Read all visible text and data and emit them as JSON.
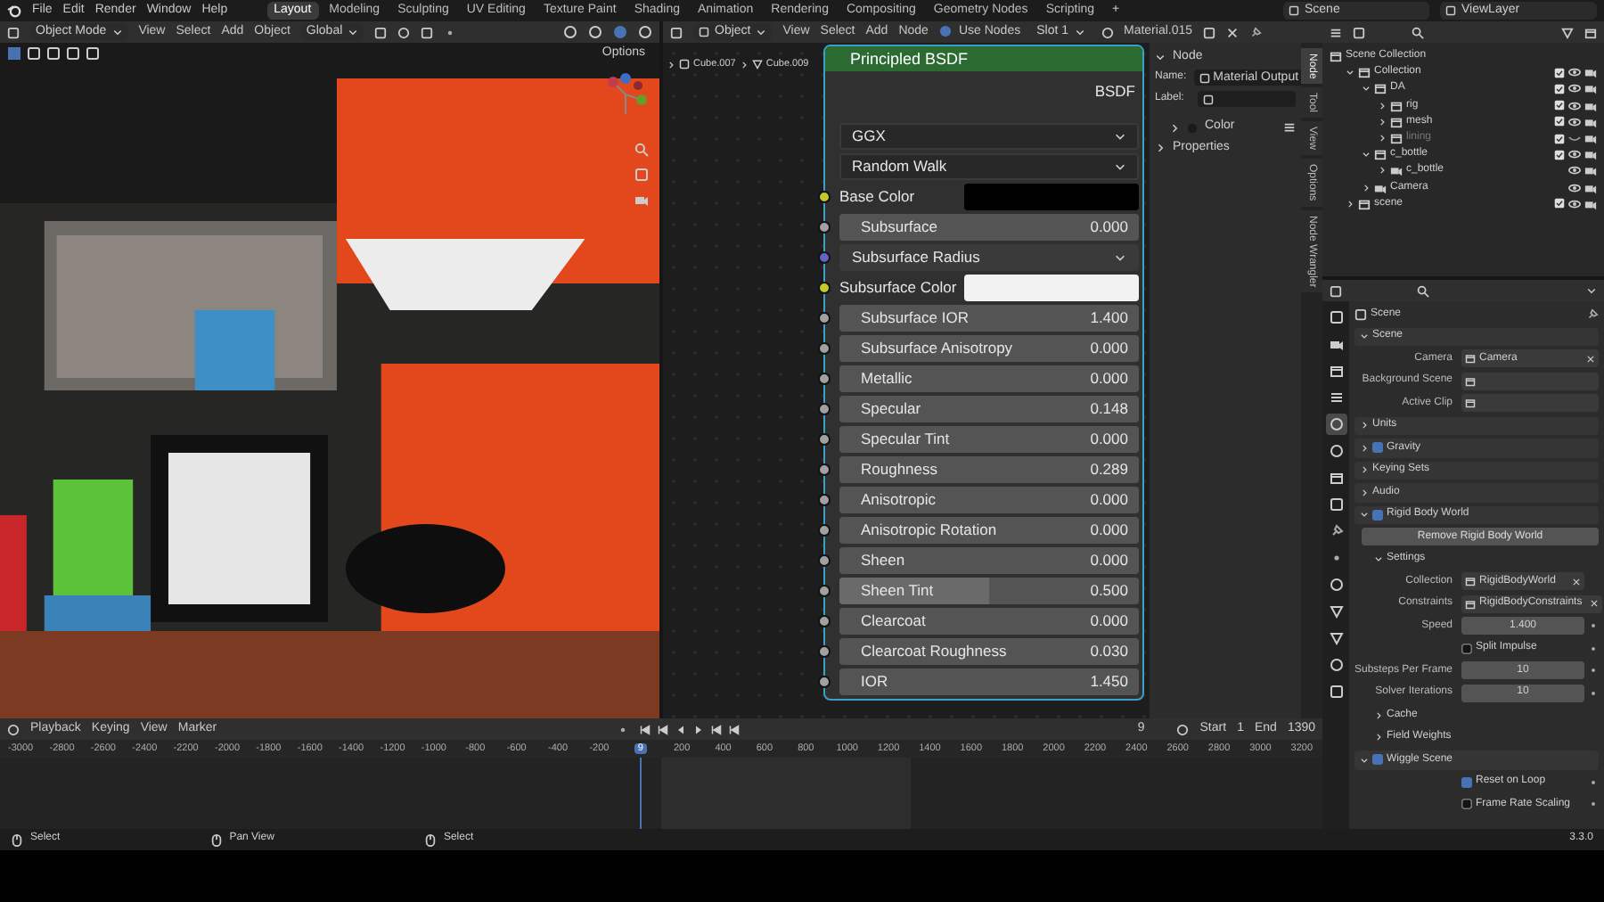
{
  "top_bar": {
    "menus": [
      "File",
      "Edit",
      "Render",
      "Window",
      "Help"
    ],
    "workspaces": [
      {
        "label": "Layout",
        "selected": true
      },
      {
        "label": "Modeling",
        "selected": false
      },
      {
        "label": "Sculpting",
        "selected": false
      },
      {
        "label": "UV Editing",
        "selected": false
      },
      {
        "label": "Texture Paint",
        "selected": false
      },
      {
        "label": "Shading",
        "selected": false
      },
      {
        "label": "Animation",
        "selected": false
      },
      {
        "label": "Rendering",
        "selected": false
      },
      {
        "label": "Compositing",
        "selected": false
      },
      {
        "label": "Geometry Nodes",
        "selected": false
      },
      {
        "label": "Scripting",
        "selected": false
      }
    ],
    "add_tab": "+",
    "scene": "Scene",
    "view_layer": "ViewLayer"
  },
  "viewport": {
    "mode": "Object Mode",
    "menus": [
      "View",
      "Select",
      "Add",
      "Object"
    ],
    "orientation": "Global",
    "options": "Options"
  },
  "node_editor": {
    "object_type": "Object",
    "menus": [
      "View",
      "Select",
      "Add",
      "Node"
    ],
    "use_nodes": {
      "label": "Use Nodes",
      "checked": true
    },
    "slot": "Slot 1",
    "material": "Material.015",
    "breadcrumbs": [
      "Cube.007",
      "Cube.009"
    ],
    "node": {
      "title": "Principled BSDF",
      "output": "BSDF",
      "dropdowns": [
        "GGX",
        "Random Walk"
      ],
      "inputs": [
        {
          "kind": "color",
          "label": "Base Color",
          "color": "#000000"
        },
        {
          "kind": "value",
          "label": "Subsurface",
          "value": "0.000"
        },
        {
          "kind": "vector",
          "label": "Subsurface Radius"
        },
        {
          "kind": "color",
          "label": "Subsurface Color",
          "color": "#f2f2f2"
        },
        {
          "kind": "value",
          "label": "Subsurface IOR",
          "value": "1.400"
        },
        {
          "kind": "value",
          "label": "Subsurface Anisotropy",
          "value": "0.000"
        },
        {
          "kind": "value",
          "label": "Metallic",
          "value": "0.000"
        },
        {
          "kind": "value",
          "label": "Specular",
          "value": "0.148"
        },
        {
          "kind": "value",
          "label": "Specular Tint",
          "value": "0.000"
        },
        {
          "kind": "value",
          "label": "Roughness",
          "value": "0.289"
        },
        {
          "kind": "value",
          "label": "Anisotropic",
          "value": "0.000"
        },
        {
          "kind": "value",
          "label": "Anisotropic Rotation",
          "value": "0.000"
        },
        {
          "kind": "value",
          "label": "Sheen",
          "value": "0.000"
        },
        {
          "kind": "value",
          "label": "Sheen Tint",
          "value": "0.500",
          "level": 0.5
        },
        {
          "kind": "value",
          "label": "Clearcoat",
          "value": "0.000"
        },
        {
          "kind": "value",
          "label": "Clearcoat Roughness",
          "value": "0.030"
        },
        {
          "kind": "value",
          "label": "IOR",
          "value": "1.450"
        }
      ]
    }
  },
  "sidebar": {
    "tabs": [
      {
        "label": "Node",
        "selected": true
      },
      {
        "label": "Tool",
        "selected": false
      },
      {
        "label": "View",
        "selected": false
      },
      {
        "label": "Options",
        "selected": false
      },
      {
        "label": "Node Wrangler",
        "selected": false
      }
    ],
    "panel": "Node",
    "name_label": "Name:",
    "name": "Material Output",
    "label_label": "Label:",
    "color_label": "Color",
    "properties": "Properties"
  },
  "outliner": {
    "items": [
      {
        "kind": "root",
        "label": "Scene Collection",
        "children": [
          {
            "kind": "collection",
            "label": "Collection",
            "expanded": true,
            "checked": true,
            "visible": true,
            "disabled": false,
            "children": [
              {
                "kind": "collection",
                "label": "DA",
                "expanded": true,
                "checked": true,
                "visible": true,
                "disabled": false,
                "children": [
                  {
                    "kind": "collection",
                    "label": "rig",
                    "expanded": false,
                    "checked": true,
                    "visible": true,
                    "disabled": false
                  },
                  {
                    "kind": "collection",
                    "label": "mesh",
                    "expanded": false,
                    "checked": true,
                    "visible": true,
                    "disabled": false
                  },
                  {
                    "kind": "collection",
                    "label": "lining",
                    "expanded": false,
                    "checked": true,
                    "visible": false,
                    "disabled": true
                  }
                ]
              },
              {
                "kind": "collection",
                "label": "c_bottle",
                "expanded": true,
                "checked": true,
                "visible": true,
                "disabled": false,
                "children": [
                  {
                    "kind": "object",
                    "label": "c_bottle",
                    "expanded": false,
                    "visible": true,
                    "disabled": false
                  }
                ]
              },
              {
                "kind": "object",
                "label": "Camera",
                "expanded": false,
                "visible": true,
                "disabled": false
              }
            ]
          },
          {
            "kind": "collection",
            "label": "scene",
            "expanded": false,
            "checked": true,
            "visible": true,
            "disabled": false
          }
        ]
      }
    ]
  },
  "properties": {
    "tabs": [
      {
        "selected": false
      },
      {
        "selected": false
      },
      {
        "selected": false
      },
      {
        "selected": false
      },
      {
        "selected": true
      },
      {
        "selected": false
      },
      {
        "selected": false
      },
      {
        "selected": false
      },
      {
        "selected": false
      },
      {
        "selected": false
      },
      {
        "selected": false
      },
      {
        "selected": false
      },
      {
        "selected": false
      },
      {
        "selected": false
      },
      {
        "selected": false
      }
    ],
    "header": "Scene",
    "panels": [
      {
        "kind": "panel",
        "title": "Scene",
        "expanded": true,
        "items": [
          {
            "kind": "object_field",
            "label": "Camera",
            "value": "Camera"
          },
          {
            "kind": "object_field",
            "label": "Background Scene"
          },
          {
            "kind": "object_field",
            "label": "Active Clip"
          }
        ]
      },
      {
        "kind": "panel",
        "title": "Units",
        "expanded": false
      },
      {
        "kind": "panel",
        "title": "Gravity",
        "expanded": false,
        "checked": true
      },
      {
        "kind": "panel",
        "title": "Keying Sets",
        "expanded": false
      },
      {
        "kind": "panel",
        "title": "Audio",
        "expanded": false
      },
      {
        "kind": "panel",
        "title": "Rigid Body World",
        "expanded": true,
        "checked": true,
        "items": [
          {
            "kind": "button",
            "label": "Remove Rigid Body World"
          },
          {
            "kind": "panel",
            "title": "Settings",
            "expanded": true,
            "items": [
              {
                "kind": "object_field",
                "label": "Collection",
                "value": "RigidBodyWorld"
              },
              {
                "kind": "object_field",
                "label": "Constraints",
                "value": "RigidBodyConstraints"
              },
              {
                "kind": "number_field",
                "label": "Speed",
                "value": "1.400"
              },
              {
                "kind": "checkbox",
                "label": "Split Impulse",
                "checked": false
              },
              {
                "kind": "number_field",
                "label": "Substeps Per Frame",
                "value": "10"
              },
              {
                "kind": "number_field",
                "label": "Solver Iterations",
                "value": "10"
              }
            ]
          },
          {
            "kind": "panel",
            "title": "Cache",
            "expanded": false
          },
          {
            "kind": "panel",
            "title": "Field Weights",
            "expanded": false
          }
        ]
      },
      {
        "kind": "panel",
        "title": "Wiggle Scene",
        "expanded": true,
        "checked": true,
        "items": [
          {
            "kind": "checkbox",
            "label": "Reset on Loop",
            "checked": true
          },
          {
            "kind": "checkbox",
            "label": "Frame Rate Scaling",
            "checked": false
          }
        ]
      }
    ]
  },
  "timeline": {
    "menus": [
      "Playback",
      "Keying",
      "View",
      "Marker"
    ],
    "current_frame": "9",
    "start_label": "Start",
    "start": "1",
    "end_label": "End",
    "end": "1390",
    "ruler_before": [
      "-3000",
      "-2800",
      "-2600",
      "-2400",
      "-2200",
      "-2000",
      "-1800",
      "-1600",
      "-1400",
      "-1200",
      "-1000",
      "-800",
      "-600",
      "-400",
      "-200"
    ],
    "playhead": "9",
    "ruler_after": [
      "200",
      "400",
      "600",
      "800",
      "1000",
      "1200",
      "1400",
      "1600",
      "1800",
      "2000",
      "2200",
      "2400",
      "2600",
      "2800",
      "3000",
      "3200"
    ]
  },
  "status_bar": {
    "hints": [
      "Select",
      "Pan View",
      "Select"
    ],
    "version": "3.3.0"
  }
}
